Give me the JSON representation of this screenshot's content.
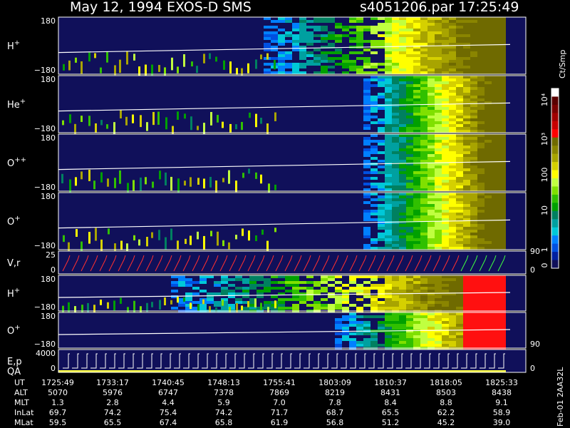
{
  "header": {
    "title": "May 12, 1994   EXOS-D SMS",
    "file": "s4051206.par  17:25:49"
  },
  "side_labels": {
    "colorbar_unit": "Ct/Smp",
    "footer_code": "Feb-01 2AA32L"
  },
  "chart_data": {
    "type": "heatmap",
    "panels": [
      {
        "label": "H",
        "sup": "+",
        "ytop": "180",
        "ybot": "−180"
      },
      {
        "label": "He",
        "sup": "+",
        "ytop": "180",
        "ybot": "−180"
      },
      {
        "label": "O",
        "sup": "++",
        "ytop": "180",
        "ybot": "−180"
      },
      {
        "label": "O",
        "sup": "+",
        "ytop": "180",
        "ybot": "−180"
      },
      {
        "label": "V,r",
        "sup": "",
        "ytop": "25",
        "ybot": "0",
        "right_top": "90",
        "right_bot": "0"
      },
      {
        "label": "H",
        "sup": "+",
        "ytop": "180",
        "ybot": "−180"
      },
      {
        "label": "O",
        "sup": "+",
        "ytop": "180",
        "ybot": "−180",
        "right_bot": "90"
      },
      {
        "label": "E,p",
        "label2": "QA",
        "sup": "",
        "ytop": "4000",
        "ybot": "0",
        "right_bot": "0"
      }
    ],
    "colorbar": {
      "ticks": [
        "10⁴",
        "10³",
        "100",
        "10",
        "1",
        "0"
      ],
      "colors": [
        "#ffffff",
        "#5a0000",
        "#7a0000",
        "#a00000",
        "#c80000",
        "#ff0000",
        "#6f6a00",
        "#8a8500",
        "#a8a400",
        "#d5d000",
        "#ffff00",
        "#c0ff40",
        "#80e000",
        "#30c000",
        "#00a000",
        "#008060",
        "#00a0a0",
        "#00c8d8",
        "#0080ff",
        "#0050e0",
        "#0020a0",
        "#10105a"
      ]
    },
    "table": {
      "rows": [
        {
          "name": "UT",
          "values": [
            "1725:49",
            "1733:17",
            "1740:45",
            "1748:13",
            "1755:41",
            "1803:09",
            "1810:37",
            "1818:05",
            "1825:33"
          ]
        },
        {
          "name": "ALT",
          "values": [
            "5070",
            "5976",
            "6747",
            "7378",
            "7869",
            "8219",
            "8431",
            "8503",
            "8438"
          ]
        },
        {
          "name": "MLT",
          "values": [
            "1.3",
            "2.8",
            "4.4",
            "5.9",
            "7.0",
            "7.8",
            "8.4",
            "8.8",
            "9.1"
          ]
        },
        {
          "name": "InLat",
          "values": [
            "69.7",
            "74.2",
            "75.4",
            "74.2",
            "71.7",
            "68.7",
            "65.5",
            "62.2",
            "58.9"
          ]
        },
        {
          "name": "MLat",
          "values": [
            "59.5",
            "65.5",
            "67.4",
            "65.8",
            "61.9",
            "56.8",
            "51.2",
            "45.2",
            "39.0"
          ]
        }
      ]
    }
  }
}
